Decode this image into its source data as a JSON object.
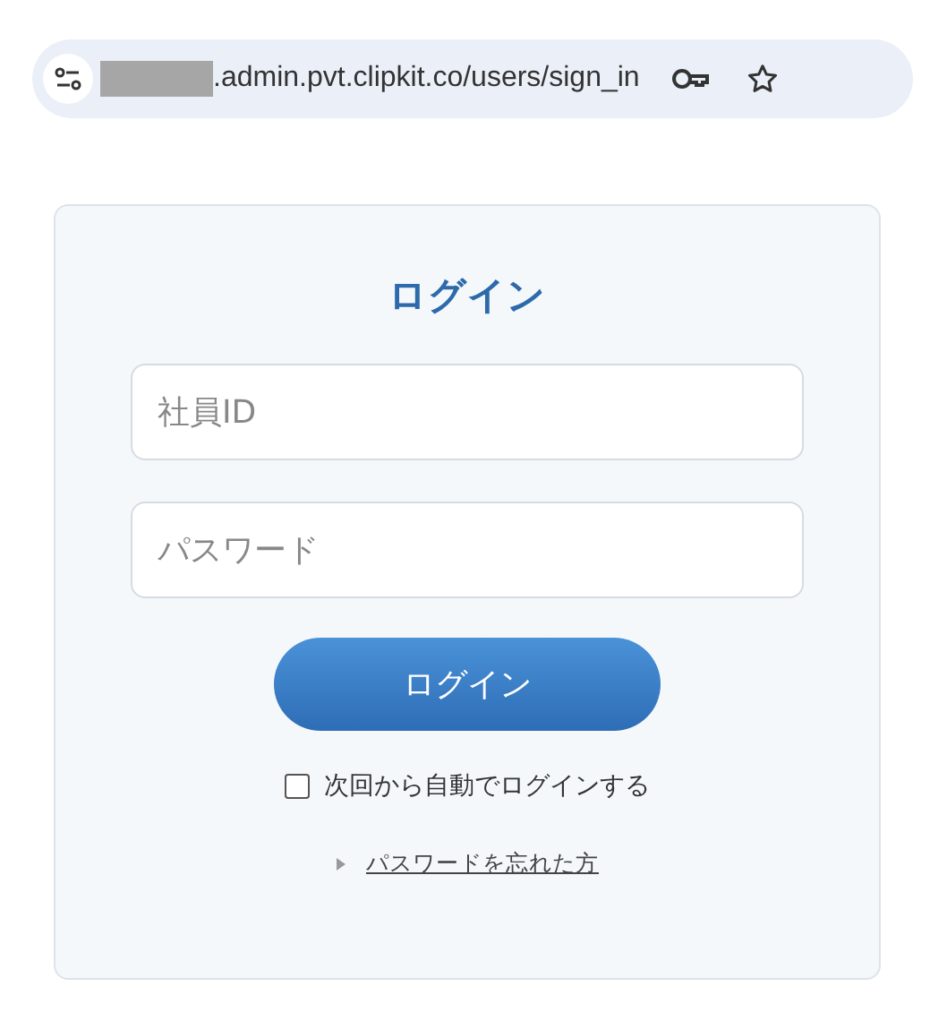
{
  "address_bar": {
    "url": ".admin.pvt.clipkit.co/users/sign_in"
  },
  "login": {
    "title": "ログイン",
    "fields": [
      {
        "placeholder": "社員ID"
      },
      {
        "placeholder": "パスワード"
      }
    ],
    "button": "ログイン",
    "remember": {
      "label": "次回から自動でログインする",
      "checked": false
    },
    "forgot_link": "パスワードを忘れた方"
  }
}
